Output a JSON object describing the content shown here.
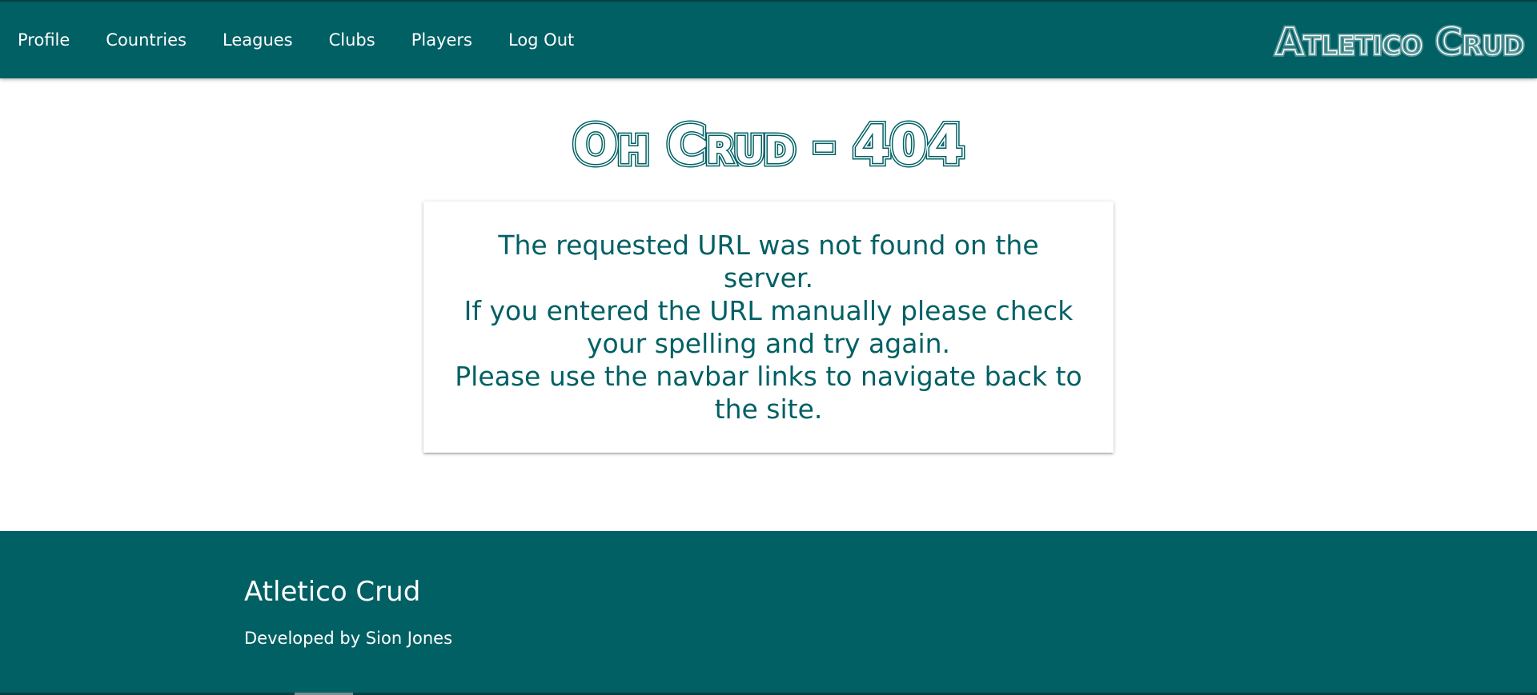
{
  "navbar": {
    "links": [
      {
        "label": "Profile"
      },
      {
        "label": "Countries"
      },
      {
        "label": "Leagues"
      },
      {
        "label": "Clubs"
      },
      {
        "label": "Players"
      },
      {
        "label": "Log Out"
      }
    ],
    "brand": "Atletico Crud"
  },
  "main": {
    "heading": "Oh Crud - 404",
    "message_lines": [
      "The requested URL was not found on the server.",
      "If you entered the URL manually please check",
      "your spelling and try again.",
      "Please use the navbar links to navigate back to",
      "the site."
    ]
  },
  "footer": {
    "title": "Atletico Crud",
    "subtitle": "Developed by Sion Jones"
  },
  "colors": {
    "primary": "#006064",
    "text_on_primary": "#ffffff",
    "background": "#ffffff"
  }
}
